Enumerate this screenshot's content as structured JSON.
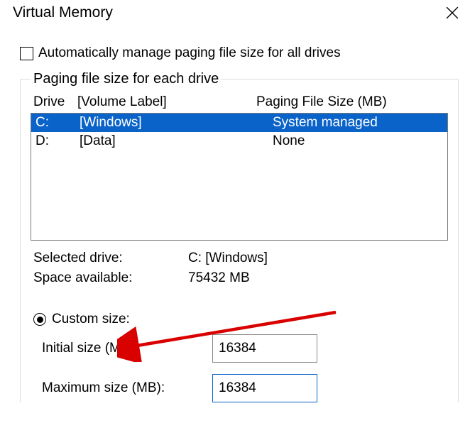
{
  "title": "Virtual Memory",
  "auto_manage": {
    "checked": false,
    "label": "Automatically manage paging file size for all drives"
  },
  "group_label": "Paging file size for each drive",
  "columns": {
    "drive": "Drive",
    "label": "[Volume Label]",
    "size": "Paging File Size (MB)"
  },
  "drives": [
    {
      "letter": "C:",
      "label": "[Windows]",
      "size": "System managed",
      "selected": true
    },
    {
      "letter": "D:",
      "label": "[Data]",
      "size": "None",
      "selected": false
    }
  ],
  "selected_drive": {
    "label": "Selected drive:",
    "value": "C:  [Windows]"
  },
  "space_available": {
    "label": "Space available:",
    "value": "75432 MB"
  },
  "custom_size": {
    "checked": true,
    "label": "Custom size:"
  },
  "initial": {
    "label": "Initial size (MB):",
    "value": "16384"
  },
  "maximum": {
    "label": "Maximum size (MB):",
    "value": "16384"
  }
}
